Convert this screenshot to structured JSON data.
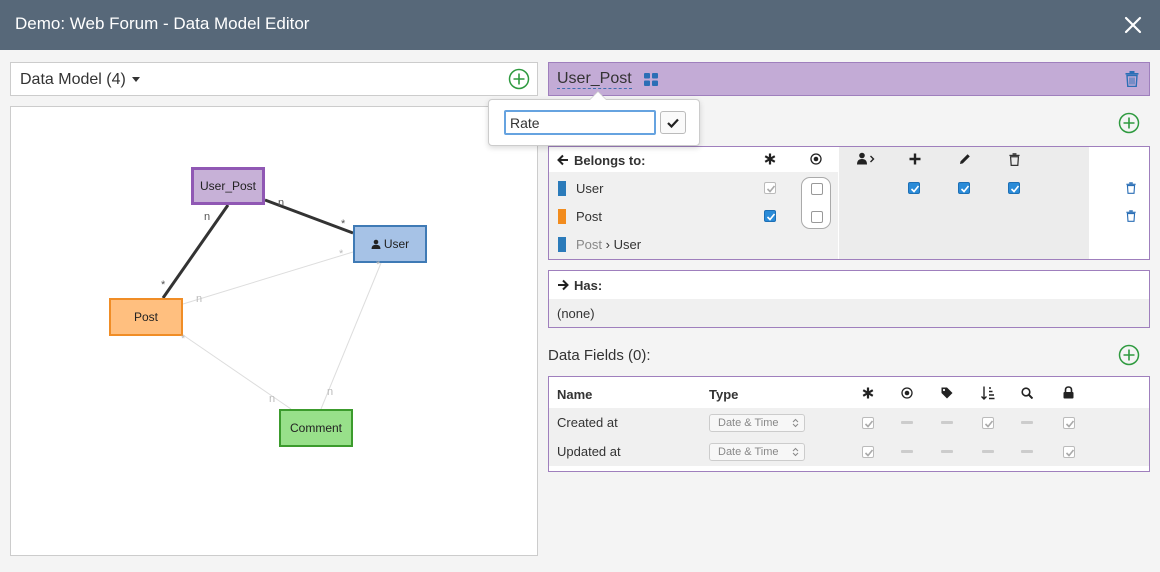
{
  "window": {
    "title": "Demo: Web Forum - Data Model Editor"
  },
  "data_model": {
    "label": "Data Model (4)"
  },
  "diagram": {
    "nodes": {
      "user_post": "User_Post",
      "user": "User",
      "post": "Post",
      "comment": "Comment"
    },
    "link_label": "n",
    "link_star": "*"
  },
  "entity": {
    "name": "User_Post"
  },
  "rename_popover": {
    "value": "Rate"
  },
  "belongs_to": {
    "title": "Belongs to:",
    "rows": [
      {
        "label": "User",
        "color": "#2b7bba"
      },
      {
        "label": "Post",
        "color": "#f28c1e"
      },
      {
        "prefix": "Post",
        "label": "User",
        "color": "#2b7bba"
      }
    ]
  },
  "has": {
    "title": "Has:",
    "empty": "(none)"
  },
  "data_fields": {
    "title": "Data Fields (0):",
    "columns": {
      "name": "Name",
      "type": "Type"
    },
    "rows": [
      {
        "name": "Created at",
        "type": "Date & Time"
      },
      {
        "name": "Updated at",
        "type": "Date & Time"
      }
    ]
  },
  "colors": {
    "titlebar": "#576879",
    "accent_green": "#2e9a3f",
    "entity_purple": "#c3abd6"
  }
}
